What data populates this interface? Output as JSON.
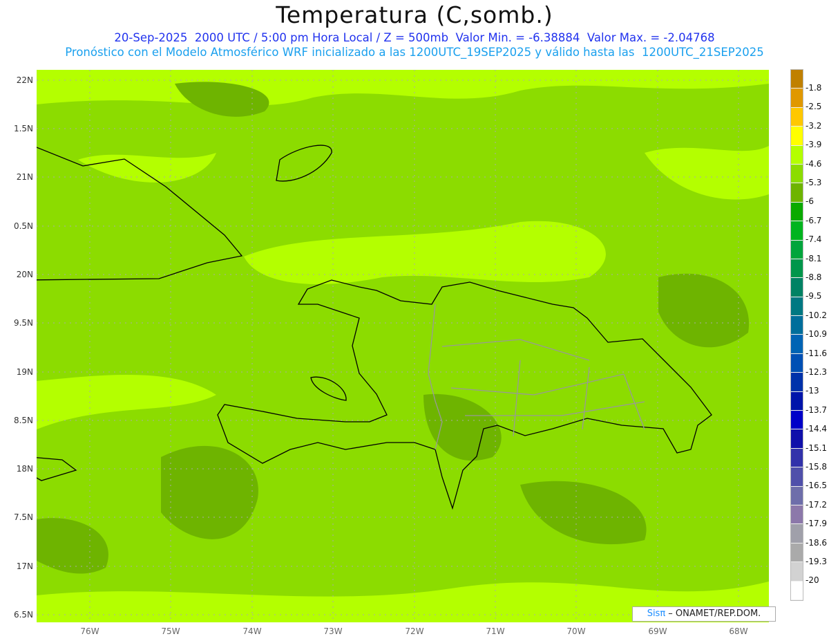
{
  "header": {
    "title": "Temperatura (C,somb.)",
    "line1": "20-Sep-2025  2000 UTC / 5:00 pm Hora Local / Z = 500mb  Valor Min. = -6.38884  Valor Max. = -2.04768",
    "line2": "Pronóstico con el Modelo Atmosférico WRF inicializado a las 1200UTC_19SEP2025 y válido hasta las  1200UTC_21SEP2025"
  },
  "axes": {
    "lat_labels": [
      "22N",
      "1.5N",
      "21N",
      "0.5N",
      "20N",
      "9.5N",
      "19N",
      "8.5N",
      "18N",
      "7.5N",
      "17N",
      "6.5N"
    ],
    "lon_labels": [
      "76W",
      "75W",
      "74W",
      "73W",
      "72W",
      "71W",
      "70W",
      "69W",
      "68W"
    ]
  },
  "colorbar": {
    "labels": [
      "-1.8",
      "-2.5",
      "-3.2",
      "-3.9",
      "-4.6",
      "-5.3",
      "-6",
      "-6.7",
      "-7.4",
      "-8.1",
      "-8.8",
      "-9.5",
      "-10.2",
      "-10.9",
      "-11.6",
      "-12.3",
      "-13",
      "-13.7",
      "-14.4",
      "-15.1",
      "-15.8",
      "-16.5",
      "-17.2",
      "-17.9",
      "-18.6",
      "-19.3",
      "-20"
    ],
    "colors": [
      "#c08000",
      "#e09800",
      "#ffc800",
      "#ffff00",
      "#b4ff00",
      "#8cdc00",
      "#6eb400",
      "#0aaa00",
      "#00b41e",
      "#00a53c",
      "#00964b",
      "#008264",
      "#007882",
      "#006e9b",
      "#0064b4",
      "#0050b4",
      "#0032aa",
      "#0014aa",
      "#0000c8",
      "#1010aa",
      "#3232aa",
      "#5050aa",
      "#6e6eaa",
      "#8c78aa",
      "#a0a0aa",
      "#aaaaaa",
      "#d2d2d2",
      "#ffffff"
    ]
  },
  "credit": {
    "brand": "Sisπ",
    "org": " – ONAMET/REP.DOM."
  }
}
